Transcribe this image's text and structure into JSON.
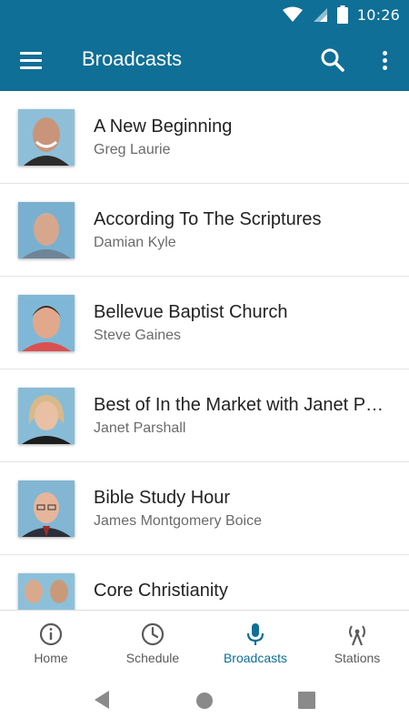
{
  "status_bar": {
    "time": "10:26"
  },
  "app_bar": {
    "title": "Broadcasts"
  },
  "broadcasts": [
    {
      "title": "A New Beginning",
      "host": "Greg Laurie"
    },
    {
      "title": "According To The Scriptures",
      "host": "Damian Kyle"
    },
    {
      "title": "Bellevue Baptist Church",
      "host": "Steve Gaines"
    },
    {
      "title": "Best of In the Market with Janet Parshall",
      "host": "Janet Parshall"
    },
    {
      "title": "Bible Study Hour",
      "host": "James Montgomery Boice"
    },
    {
      "title": "Core Christianity",
      "host": ""
    }
  ],
  "bottom_nav": [
    {
      "label": "Home",
      "icon": "info-icon",
      "active": false
    },
    {
      "label": "Schedule",
      "icon": "clock-icon",
      "active": false
    },
    {
      "label": "Broadcasts",
      "icon": "microphone-icon",
      "active": true
    },
    {
      "label": "Stations",
      "icon": "antenna-icon",
      "active": false
    }
  ],
  "colors": {
    "primary": "#0f6f96",
    "text": "#222222",
    "subtext": "#6b6b6b"
  }
}
